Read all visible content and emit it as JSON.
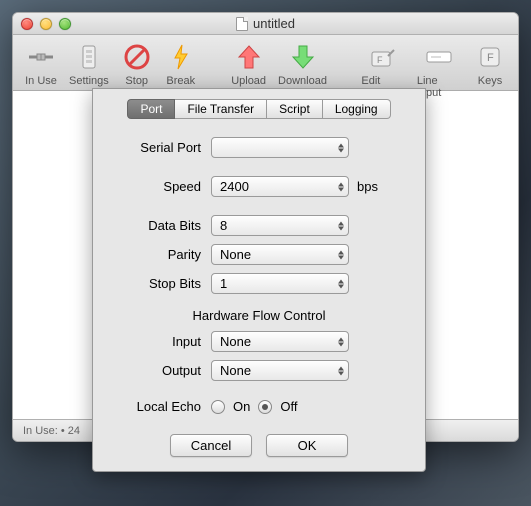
{
  "window": {
    "title": "untitled"
  },
  "toolbar": {
    "items": [
      {
        "label": "In Use"
      },
      {
        "label": "Settings"
      },
      {
        "label": "Stop"
      },
      {
        "label": "Break"
      },
      {
        "label": "Upload"
      },
      {
        "label": "Download"
      },
      {
        "label": "Edit Keys"
      },
      {
        "label": "Line Input"
      },
      {
        "label": "Keys"
      }
    ]
  },
  "statusbar": {
    "text": "In Use:  • 24"
  },
  "sheet": {
    "tabs": [
      {
        "label": "Port",
        "active": true
      },
      {
        "label": "File Transfer"
      },
      {
        "label": "Script"
      },
      {
        "label": "Logging"
      }
    ],
    "fields": {
      "serial_port": {
        "label": "Serial Port",
        "value": ""
      },
      "speed": {
        "label": "Speed",
        "value": "2400",
        "suffix": "bps"
      },
      "data_bits": {
        "label": "Data Bits",
        "value": "8"
      },
      "parity": {
        "label": "Parity",
        "value": "None"
      },
      "stop_bits": {
        "label": "Stop Bits",
        "value": "1"
      },
      "hw_flow_title": "Hardware Flow Control",
      "input": {
        "label": "Input",
        "value": "None"
      },
      "output": {
        "label": "Output",
        "value": "None"
      },
      "local_echo": {
        "label": "Local Echo",
        "on": "On",
        "off": "Off",
        "value": "Off"
      }
    },
    "buttons": {
      "cancel": "Cancel",
      "ok": "OK"
    }
  }
}
